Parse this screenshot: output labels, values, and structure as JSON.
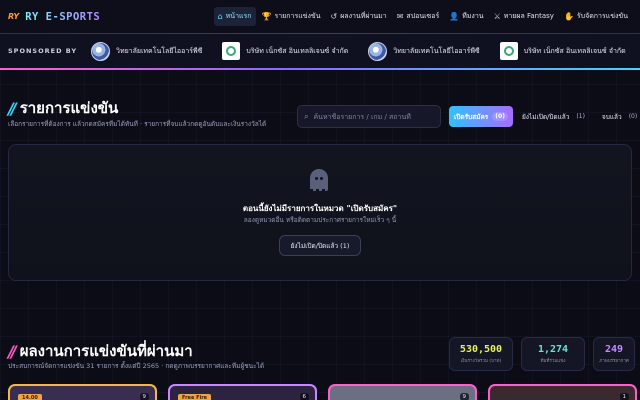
{
  "nav": {
    "logo_mark": "RY",
    "brand": "RY E-SPORTS",
    "items": [
      {
        "icon": "home-icon",
        "glyph": "⌂",
        "label": "หน้าแรก"
      },
      {
        "icon": "trophy-icon",
        "glyph": "🏆",
        "label": "รายการแข่งขัน"
      },
      {
        "icon": "history-icon",
        "glyph": "↺",
        "label": "ผลงานที่ผ่านมา"
      },
      {
        "icon": "megaphone-icon",
        "glyph": "✉",
        "label": "สปอนเซอร์"
      },
      {
        "icon": "user-icon",
        "glyph": "👤",
        "label": "ทีมงาน"
      },
      {
        "icon": "crossed-swords-icon",
        "glyph": "⚔",
        "label": "ทายผล Fantasy"
      },
      {
        "icon": "organize-icon",
        "glyph": "✋",
        "label": "รับจัดการแข่งขัน"
      }
    ]
  },
  "sponsors": {
    "label": "SPONSORED BY",
    "items": [
      {
        "logo": "round",
        "name": "วิทยาลัยเทคโนโลยีไออาร์พีซี"
      },
      {
        "logo": "square",
        "name": "บริษัท เน็กซัส อินเทลลิเจนซ์ จำกัด"
      },
      {
        "logo": "round",
        "name": "วิทยาลัยเทคโนโลยีไออาร์พีซี"
      },
      {
        "logo": "square",
        "name": "บริษัท เน็กซัส อินเทลลิเจนซ์ จำกัด"
      }
    ]
  },
  "tournaments": {
    "title": "รายการแข่งขัน",
    "subtitle": "เลือกรายการที่ต้องการ แล้วกดสมัครทีมได้ทันที · รายการที่จบแล้วกดดูอันดับและเงินรางวัลได้",
    "search_placeholder": "ค้นหาชื่อรายการ / เกม / สถานที่",
    "filters": [
      {
        "label": "เปิดรับสมัคร",
        "count": "(0)",
        "active": true
      },
      {
        "label": "ยังไม่เปิด/ปิดแล้ว",
        "count": "(1)",
        "active": false
      },
      {
        "label": "จบแล้ว",
        "count": "(0)",
        "active": false
      }
    ],
    "empty_title": "ตอนนี้ยังไม่มีรายการในหมวด \"เปิดรับสมัคร\"",
    "empty_desc": "ลองดูหมวดอื่น หรือติดตามประกาศรายการใหม่เร็ว ๆ นี้",
    "empty_button": "ยังไม่เปิด/ปิดแล้ว (1)"
  },
  "results": {
    "title": "ผลงานการแข่งขันที่ผ่านมา",
    "subtitle": "ประสบการณ์จัดการแข่งขัน 31 รายการ ตั้งแต่ปี 2565 · กดดูภาพบรรยากาศและทีมผู้ชนะได้",
    "stats": [
      {
        "value": "530,500",
        "label": "เงินรางวัลรวม (บาท)",
        "color": "#e6f25a"
      },
      {
        "value": "1,274",
        "label": "ทีมที่ร่วมแข่ง",
        "color": "#5de8d8"
      },
      {
        "value": "249",
        "label": "ภาพบรรยากาศ",
        "color": "#c48bff"
      }
    ],
    "cards": [
      {
        "badge": "14.00",
        "count": "9",
        "border": "#f2b84b",
        "bg": "#3a2d52"
      },
      {
        "badge": "Free Fire",
        "count": "6",
        "border": "#c987ff",
        "bg": "#2b2340"
      },
      {
        "badge": "",
        "count": "9",
        "border": "#ff5ec8",
        "bg": "#6b6f82"
      },
      {
        "badge": "",
        "count": "1",
        "border": "#ff5ec8",
        "bg": "#3a2a30"
      }
    ]
  }
}
